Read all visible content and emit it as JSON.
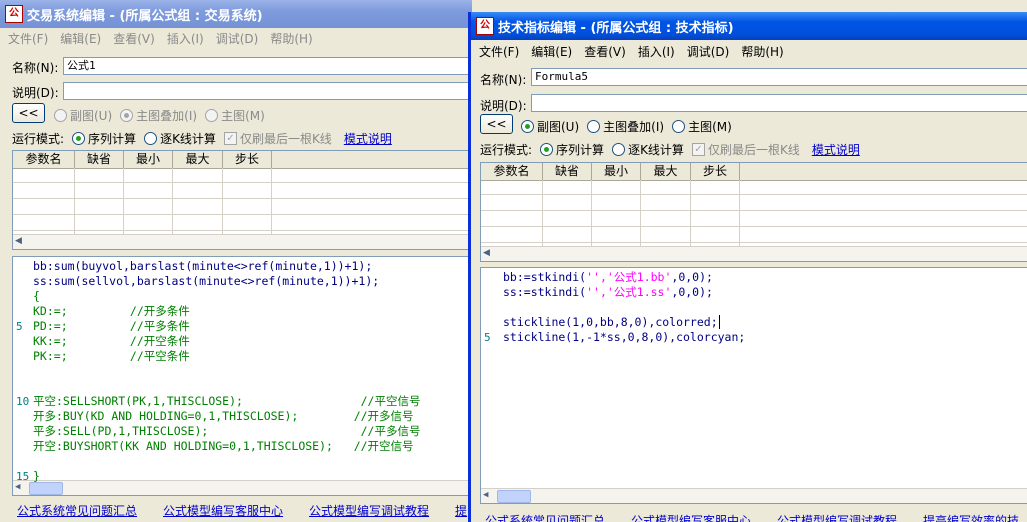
{
  "win1": {
    "title": "交易系统编辑 - (所属公式组 : 交易系统)",
    "menu": [
      "文件(F)",
      "编辑(E)",
      "查看(V)",
      "插入(I)",
      "调试(D)",
      "帮助(H)"
    ],
    "name_label": "名称(N):",
    "name_value": "公式1",
    "desc_label": "说明(D):",
    "desc_value": "",
    "collapse_label": "<<",
    "radio_sub": "副图(U)",
    "radio_overlay": "主图叠加(I)",
    "radio_main": "主图(M)",
    "mode_label": "运行模式:",
    "mode_seq": "序列计算",
    "mode_bar": "逐K线计算",
    "last_bar": "仅刷最后一根K线",
    "mode_help": "模式说明",
    "param_headers": [
      "参数名",
      "缺省",
      "最小",
      "最大",
      "步长"
    ],
    "code_lines": [
      {
        "n": "",
        "t": "bb:sum(buyvol,barslast(minute<>ref(minute,1))+1);"
      },
      {
        "n": "",
        "t": "ss:sum(sellvol,barslast(minute<>ref(minute,1))+1);"
      },
      {
        "n": "",
        "t": "{"
      },
      {
        "n": "",
        "t": "KD:=;         //开多条件"
      },
      {
        "n": "5",
        "t": "PD:=;         //平多条件"
      },
      {
        "n": "",
        "t": "KK:=;         //开空条件"
      },
      {
        "n": "",
        "t": "PK:=;         //平空条件"
      },
      {
        "n": "",
        "t": ""
      },
      {
        "n": "",
        "t": ""
      },
      {
        "n": "10",
        "t": "平空:SELLSHORT(PK,1,THISCLOSE);                 //平空信号"
      },
      {
        "n": "",
        "t": "开多:BUY(KD AND HOLDING=0,1,THISCLOSE);        //开多信号"
      },
      {
        "n": "",
        "t": "平多:SELL(PD,1,THISCLOSE);                      //平多信号"
      },
      {
        "n": "",
        "t": "开空:BUYSHORT(KK AND HOLDING=0,1,THISCLOSE);   //开空信号"
      },
      {
        "n": "",
        "t": ""
      },
      {
        "n": "15",
        "t": "}"
      }
    ],
    "bottom_links": [
      "公式系统常见问题汇总",
      "公式模型编写客服中心",
      "公式模型编写调试教程",
      "提"
    ]
  },
  "win2": {
    "title": "技术指标编辑 - (所属公式组 : 技术指标)",
    "menu": [
      "文件(F)",
      "编辑(E)",
      "查看(V)",
      "插入(I)",
      "调试(D)",
      "帮助(H)"
    ],
    "name_label": "名称(N):",
    "name_value": "Formula5",
    "desc_label": "说明(D):",
    "desc_value": "",
    "collapse_label": "<<",
    "radio_sub": "副图(U)",
    "radio_overlay": "主图叠加(I)",
    "radio_main": "主图(M)",
    "mode_label": "运行模式:",
    "mode_seq": "序列计算",
    "mode_bar": "逐K线计算",
    "last_bar": "仅刷最后一根K线",
    "mode_help": "模式说明",
    "param_headers": [
      "参数名",
      "缺省",
      "最小",
      "最大",
      "步长"
    ],
    "code": {
      "l1a": "bb:=stkindi(",
      "l1b": "'','公式1.bb'",
      "l1c": ",0,0);",
      "l2a": "ss:=stkindi(",
      "l2b": "'','公式1.ss'",
      "l2c": ",0,0);",
      "l4": "stickline(1,0,bb,8,0),colorred;",
      "l5": "stickline(1,-1*ss,0,8,0),colorcyan;",
      "ln5": "5"
    },
    "bottom_links": [
      "公式系统常见问题汇总",
      "公式模型编写客服中心",
      "公式模型编写调试教程",
      "提高编写效率的技"
    ]
  },
  "colors": {
    "title_active": "#0054e3",
    "title_inactive": "#7e9bdc",
    "code_text": "#000080",
    "comment": "#008000",
    "string": "#ff00ff",
    "link": "#0000cc"
  }
}
